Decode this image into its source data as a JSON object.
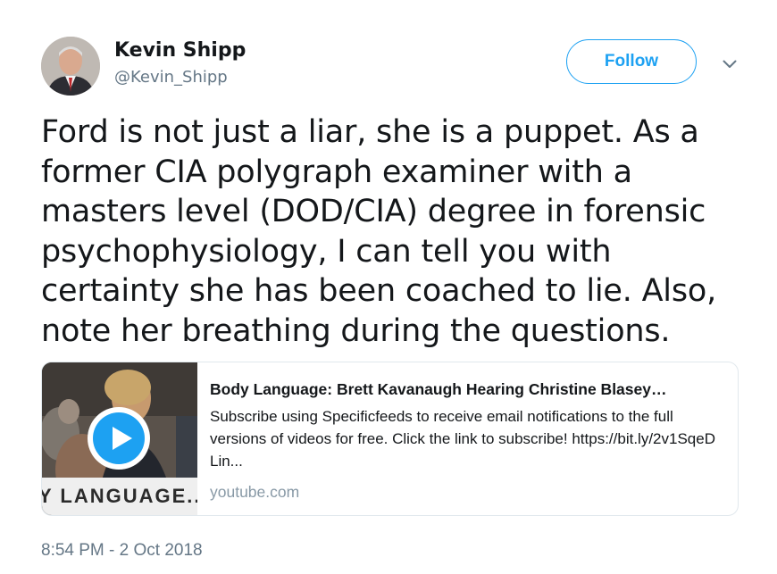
{
  "author": {
    "display_name": "Kevin Shipp",
    "handle": "@Kevin_Shipp"
  },
  "follow_button": {
    "label": "Follow"
  },
  "menu": {
    "icon": "chevron-down-icon"
  },
  "tweet": {
    "text": "Ford is not just a liar, she is a puppet. As a former CIA polygraph examiner with a masters level (DOD/CIA) degree in forensic psychophysiology, I can tell you with certainty she has been coached to lie. Also, note her breathing during the questions.",
    "timestamp": "8:54 PM - 2 Oct 2018"
  },
  "link_card": {
    "title": "Body Language: Brett Kavanaugh Hearing Christine Blasey…",
    "description": "Subscribe using Specificfeeds to receive email notifications to the full versions of videos for free. Click the link to subscribe! https://bit.ly/2v1SqeD Lin...",
    "domain": "youtube.com",
    "thumbnail_caption": "Y LANGUAGE...",
    "play_icon": "play-icon"
  },
  "colors": {
    "accent": "#1da1f2",
    "text": "#14171a",
    "muted": "#657786",
    "border": "#e1e8ed"
  }
}
